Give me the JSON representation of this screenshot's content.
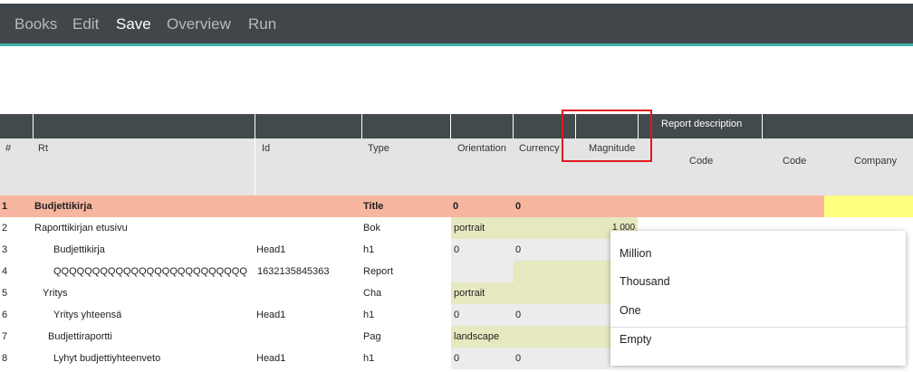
{
  "menu": {
    "items": [
      {
        "label": "Books"
      },
      {
        "label": "Edit"
      },
      {
        "label": "Save"
      },
      {
        "label": "Overview"
      },
      {
        "label": "Run"
      }
    ]
  },
  "colors": {
    "menubar": "#404649",
    "accent_line": "#3fb0a8",
    "title_row": "#f7b6a0",
    "cell_green": "#e6e8bf",
    "cell_grey": "#ececec",
    "highlight_yellow": "#ffff80",
    "callout_red": "#e0181f"
  },
  "table": {
    "group_header": "Report description",
    "columns": {
      "num": "#",
      "rt": "Rt",
      "id": "Id",
      "type": "Type",
      "orientation": "Orientation",
      "currency": "Currency",
      "magnitude": "Magnitude",
      "code1": "Code",
      "code2": "Code",
      "company": "Company"
    },
    "rows": [
      {
        "num": "1",
        "rt": "Budjettikirja",
        "id": "",
        "type": "Title",
        "orientation": "0",
        "currency": "0",
        "magnitude": ""
      },
      {
        "num": "2",
        "rt": "Raporttikirjan etusivu",
        "id": "",
        "type": "Bok",
        "orientation": "portrait",
        "currency": "",
        "magnitude": "1 000"
      },
      {
        "num": "3",
        "rt": "Budjettikirja",
        "id": "Head1",
        "type": "h1",
        "orientation": "0",
        "currency": "0",
        "magnitude": ""
      },
      {
        "num": "4",
        "rt": "QQQQQQQQQQQQQQQQQQQQQQQQQ",
        "id": "1632135845363",
        "type": "Report",
        "orientation": "",
        "currency": "",
        "magnitude": ""
      },
      {
        "num": "5",
        "rt": "Yritys",
        "id": "",
        "type": "Cha",
        "orientation": "portrait",
        "currency": "",
        "magnitude": ""
      },
      {
        "num": "6",
        "rt": "Yritys yhteensä",
        "id": "Head1",
        "type": "h1",
        "orientation": "0",
        "currency": "0",
        "magnitude": ""
      },
      {
        "num": "7",
        "rt": "Budjettiraportti",
        "id": "",
        "type": "Pag",
        "orientation": "landscape",
        "currency": "",
        "magnitude": ""
      },
      {
        "num": "8",
        "rt": "Lyhyt budjettiyhteenveto",
        "id": "Head1",
        "type": "h1",
        "orientation": "0",
        "currency": "0",
        "magnitude": ""
      }
    ]
  },
  "magnitude_dropdown": {
    "options": [
      "Million",
      "Thousand",
      "One",
      "Empty"
    ]
  }
}
